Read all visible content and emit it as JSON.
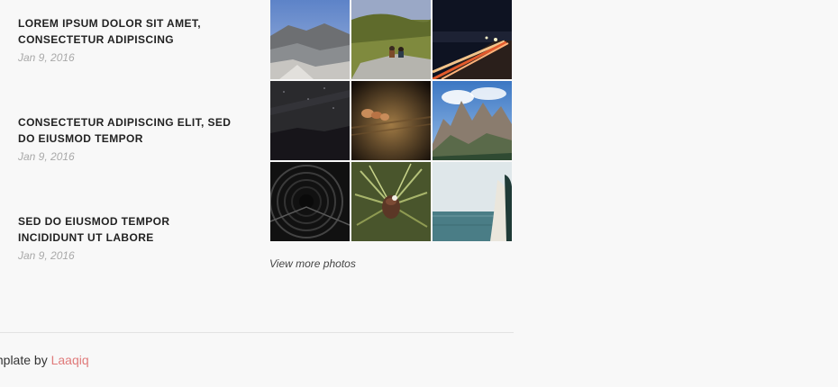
{
  "posts": [
    {
      "title": "LOREM IPSUM DOLOR SIT AMET, CONSECTETUR ADIPISCING",
      "date": "Jan 9, 2016"
    },
    {
      "title": "CONSECTETUR ADIPISCING ELIT, SED DO EIUSMOD TEMPOR",
      "date": "Jan 9, 2016"
    },
    {
      "title": "SED DO EIUSMOD TEMPOR INCIDIDUNT UT LABORE",
      "date": "Jan 9, 2016"
    }
  ],
  "photos": {
    "view_more_label": "View more photos"
  },
  "footer": {
    "credit_prefix": "mplate by",
    "credit_link": "Laaqiq"
  },
  "colors": {
    "background": "#f8f8f8",
    "link_accent": "#e07b7b"
  }
}
